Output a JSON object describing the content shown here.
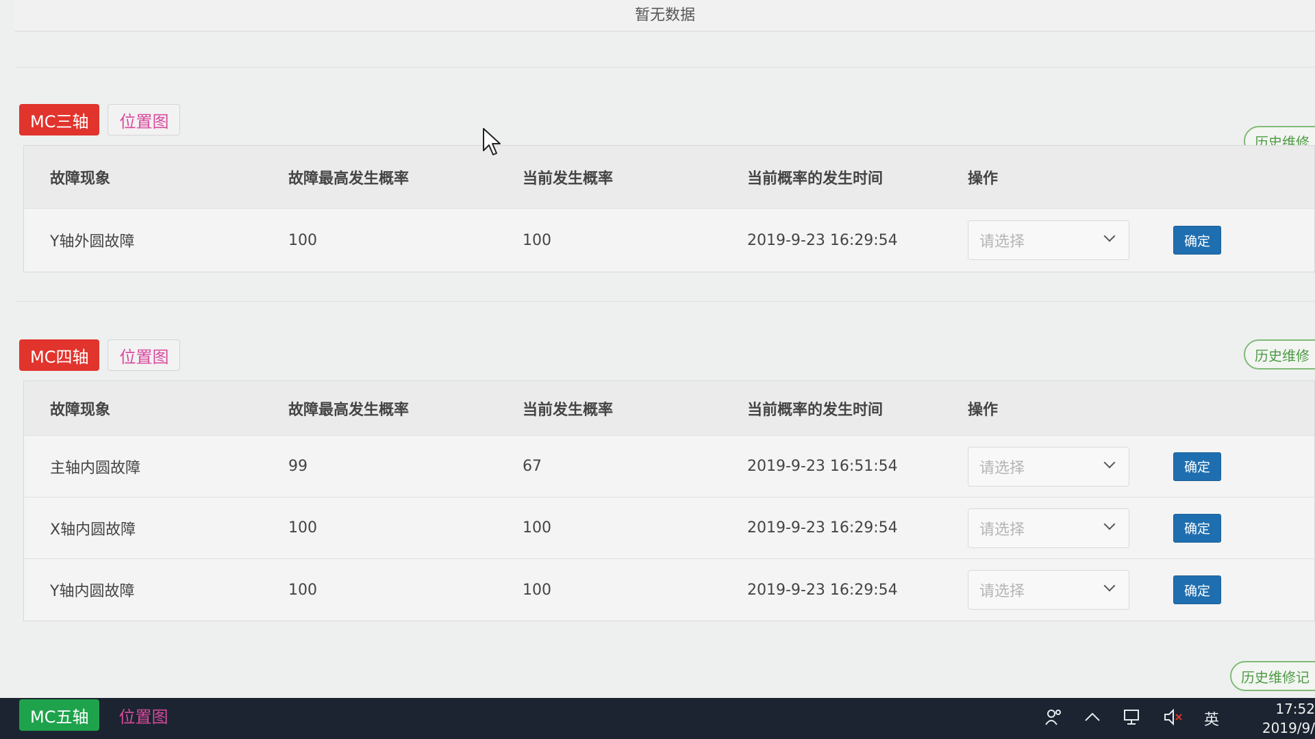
{
  "top": {
    "empty_text": "暂无数据"
  },
  "headers": [
    "故障现象",
    "故障最高发生概率",
    "当前发生概率",
    "当前概率的发生时间",
    "操作"
  ],
  "sections": [
    {
      "name": "MC三轴",
      "position_label": "位置图",
      "history_label": "历史维修",
      "rows": [
        {
          "fault": "Y轴外圆故障",
          "max_prob": "100",
          "cur_prob": "100",
          "time": "2019-9-23 16:29:54",
          "select_placeholder": "请选择",
          "confirm": "确定"
        }
      ]
    },
    {
      "name": "MC四轴",
      "position_label": "位置图",
      "history_label": "历史维修",
      "rows": [
        {
          "fault": "主轴内圆故障",
          "max_prob": "99",
          "cur_prob": "67",
          "time": "2019-9-23 16:51:54",
          "select_placeholder": "请选择",
          "confirm": "确定"
        },
        {
          "fault": "X轴内圆故障",
          "max_prob": "100",
          "cur_prob": "100",
          "time": "2019-9-23 16:29:54",
          "select_placeholder": "请选择",
          "confirm": "确定"
        },
        {
          "fault": "Y轴内圆故障",
          "max_prob": "100",
          "cur_prob": "100",
          "time": "2019-9-23 16:29:54",
          "select_placeholder": "请选择",
          "confirm": "确定"
        }
      ]
    },
    {
      "name": "MC五轴",
      "position_label": "位置图",
      "history_label": "历史维修记"
    }
  ],
  "taskbar": {
    "ime": "英",
    "time": "17:52",
    "date": "2019/9/"
  },
  "colors": {
    "red_tag": "#e0342d",
    "green_tag": "#1fa24c",
    "confirm_button": "#1f6fb0",
    "pink_text": "#d94a9d"
  }
}
